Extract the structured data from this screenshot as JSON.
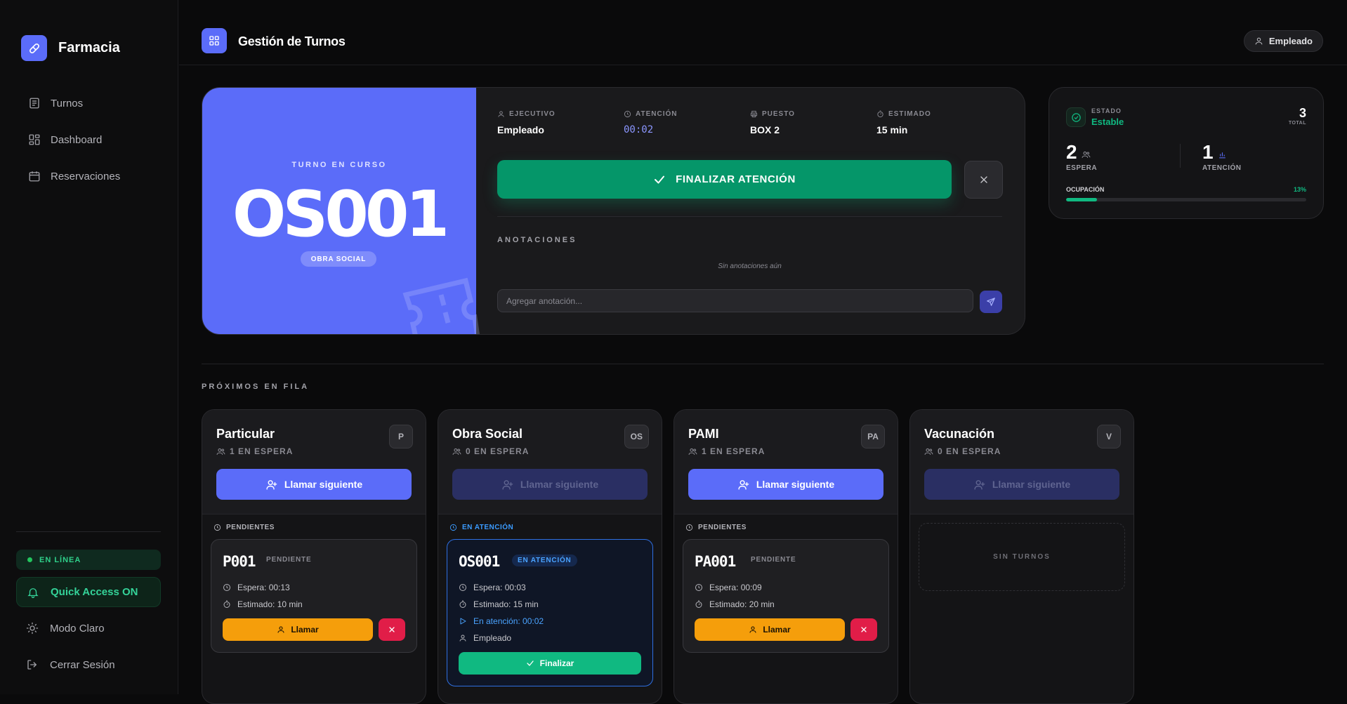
{
  "app": {
    "name": "Farmacia"
  },
  "sidebar": {
    "items": [
      {
        "label": "Turnos",
        "icon": "document-icon"
      },
      {
        "label": "Dashboard",
        "icon": "grid-icon"
      },
      {
        "label": "Reservaciones",
        "icon": "calendar-icon"
      }
    ],
    "status": "EN LÍNEA",
    "quick_access": "Quick Access ON",
    "light_mode": "Modo Claro",
    "logout": "Cerrar Sesión"
  },
  "header": {
    "title": "Gestión de Turnos",
    "user": "Empleado"
  },
  "current_turn": {
    "subtitle": "TURNO EN CURSO",
    "code": "OS001",
    "category": "OBRA SOCIAL",
    "info": [
      {
        "label": "EJECUTIVO",
        "value": "Empleado",
        "icon": "user-icon"
      },
      {
        "label": "ATENCIÓN",
        "value": "00:02",
        "icon": "clock-icon"
      },
      {
        "label": "PUESTO",
        "value": "BOX 2",
        "icon": "printer-icon"
      },
      {
        "label": "ESTIMADO",
        "value": "15 min",
        "icon": "timer-icon"
      }
    ],
    "finalize_label": "FINALIZAR ATENCIÓN",
    "notes_label": "ANOTACIONES",
    "notes_empty": "Sin anotaciones aún",
    "notes_placeholder": "Agregar anotación..."
  },
  "stats": {
    "status_label": "ESTADO",
    "status_value": "Estable",
    "total": "3",
    "total_label": "TOTAL",
    "waiting": "2",
    "waiting_label": "ESPERA",
    "attending": "1",
    "attending_label": "ATENCIÓN",
    "occupancy_label": "OCUPACIÓN",
    "occupancy_pct": "13%",
    "occupancy_value": 0.13
  },
  "queue_title": "PRÓXIMOS EN FILA",
  "queues": [
    {
      "name": "Particular",
      "waiting": "1 EN ESPERA",
      "badge": "P",
      "call_label": "Llamar siguiente",
      "call_enabled": true,
      "section": "PENDIENTES",
      "ticket": {
        "code": "P001",
        "status": "PENDIENTE",
        "wait": "Espera: 00:13",
        "estimate": "Estimado: 10 min",
        "call": "Llamar"
      }
    },
    {
      "name": "Obra Social",
      "waiting": "0 EN ESPERA",
      "badge": "OS",
      "call_label": "Llamar siguiente",
      "call_enabled": false,
      "section": "EN ATENCIÓN",
      "ticket": {
        "code": "OS001",
        "status": "EN ATENCIÓN",
        "wait": "Espera: 00:03",
        "estimate": "Estimado: 15 min",
        "attending": "En atención: 00:02",
        "employee": "Empleado",
        "finish": "Finalizar"
      }
    },
    {
      "name": "PAMI",
      "waiting": "1 EN ESPERA",
      "badge": "PA",
      "call_label": "Llamar siguiente",
      "call_enabled": true,
      "section": "PENDIENTES",
      "ticket": {
        "code": "PA001",
        "status": "PENDIENTE",
        "wait": "Espera: 00:09",
        "estimate": "Estimado: 20 min",
        "call": "Llamar"
      }
    },
    {
      "name": "Vacunación",
      "waiting": "0 EN ESPERA",
      "badge": "V",
      "call_label": "Llamar siguiente",
      "call_enabled": false,
      "empty": "SIN TURNOS"
    }
  ],
  "colors": {
    "accent": "#5b6cf9",
    "success": "#10b981",
    "warning": "#f59e0b",
    "danger": "#e11d48",
    "info": "#3b9bff"
  }
}
